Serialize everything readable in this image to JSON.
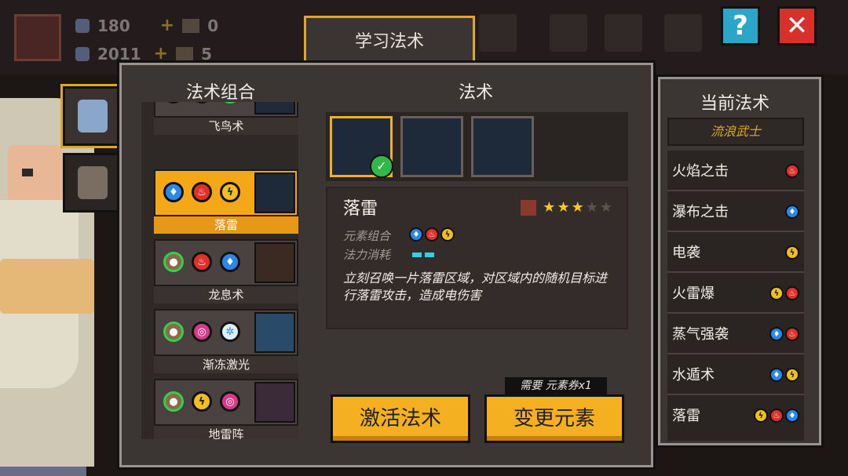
{
  "resources": {
    "gems": "180",
    "chest1": "0",
    "crystals": "2011",
    "chest2": "5"
  },
  "top_bar": {
    "help": "?",
    "close": "✕"
  },
  "title_tab": "学习法术",
  "headers": {
    "combos": "法术组合",
    "spells": "法术"
  },
  "combos": [
    {
      "name": "飞鸟术",
      "elements": [
        "water",
        "thunder",
        "earth"
      ]
    },
    {
      "name": "落雷",
      "elements": [
        "water",
        "fire",
        "thunder"
      ],
      "active": true
    },
    {
      "name": "龙息术",
      "elements": [
        "earth",
        "fire",
        "water"
      ]
    },
    {
      "name": "渐冻激光",
      "elements": [
        "earth",
        "poison",
        "ice"
      ]
    },
    {
      "name": "地雷阵",
      "elements": [
        "earth",
        "thunder",
        "poison"
      ]
    }
  ],
  "detail": {
    "name": "落雷",
    "stars": 3,
    "max_stars": 5,
    "element_label": "元素组合",
    "mana_label": "法力消耗",
    "elements": [
      "water",
      "fire",
      "thunder"
    ],
    "description": "立刻召唤一片落雷区域，对区域内的随机目标进行落雷攻击，造成电伤害"
  },
  "requirement": "需要 元素券x1",
  "buttons": {
    "activate": "激活法术",
    "change": "变更元素"
  },
  "current": {
    "title": "当前法术",
    "subtitle": "流浪武士",
    "spells": [
      {
        "name": "火焰之击",
        "elements": [
          "fire"
        ]
      },
      {
        "name": "瀑布之击",
        "elements": [
          "water"
        ]
      },
      {
        "name": "电袭",
        "elements": [
          "thunder"
        ]
      },
      {
        "name": "火雷爆",
        "elements": [
          "thunder",
          "fire"
        ]
      },
      {
        "name": "蒸气强袭",
        "elements": [
          "water",
          "fire"
        ]
      },
      {
        "name": "水遁术",
        "elements": [
          "water",
          "thunder"
        ]
      },
      {
        "name": "落雷",
        "elements": [
          "thunder",
          "fire",
          "water"
        ]
      }
    ]
  },
  "element_glyphs": {
    "water": "♦",
    "fire": "♨",
    "thunder": "ϟ",
    "earth": "●",
    "poison": "◎",
    "ice": "✲"
  },
  "colors": {
    "accent": "#f4b020",
    "panel": "#3b3533",
    "water": "#2a88e8",
    "fire": "#e0302a",
    "thunder": "#f0c020"
  }
}
